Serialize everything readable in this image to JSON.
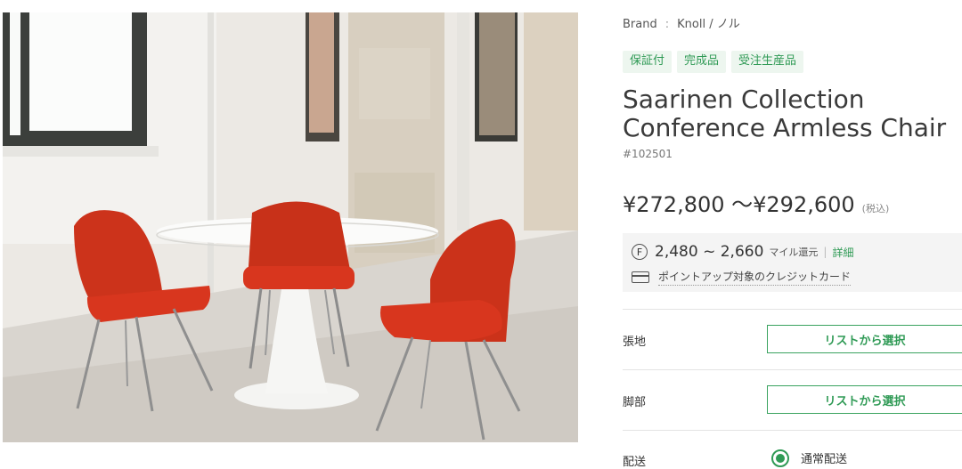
{
  "product": {
    "brand_label": "Brand",
    "brand_sep": ":",
    "brand_name": "Knoll / ノル",
    "tags": [
      "保証付",
      "完成品",
      "受注生産品"
    ],
    "title_line1": "Saarinen Collection",
    "title_line2": "Conference Armless Chair",
    "sku": "#102501",
    "price_range": "¥272,800 ～¥292,600",
    "tax_note": "(税込)"
  },
  "miles": {
    "badge": "F",
    "range": "2,480 ~ 2,660",
    "unit": "マイル還元",
    "separator": "|",
    "detail_link": "詳細",
    "card_text": "ポイントアップ対象のクレジットカード"
  },
  "options": [
    {
      "label": "張地",
      "button": "リストから選択"
    },
    {
      "label": "脚部",
      "button": "リストから選択"
    }
  ],
  "shipping": {
    "label": "配送",
    "selected": "通常配送"
  },
  "colors": {
    "accent": "#2f9a55",
    "tag_bg": "#edf6ef",
    "chair_red": "#d8361e"
  }
}
